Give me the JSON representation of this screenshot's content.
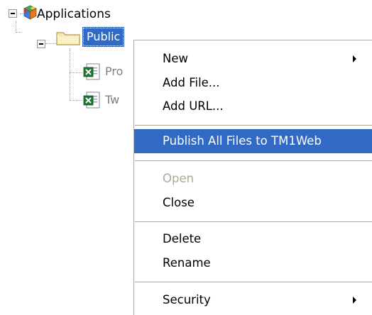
{
  "tree": {
    "root": {
      "label": "Applications",
      "expander": "minus"
    },
    "public": {
      "label": "Public",
      "expander": "minus"
    },
    "children": [
      {
        "label": "Pro",
        "icon": "excel-document-icon"
      },
      {
        "label": "Tw",
        "icon": "excel-document-icon"
      }
    ]
  },
  "context_menu": {
    "items": [
      {
        "label": "New",
        "submenu": true
      },
      {
        "label": "Add File...",
        "submenu": false
      },
      {
        "label": "Add URL...",
        "submenu": false
      },
      {
        "label": "Publish All Files to TM1Web",
        "selected": true
      },
      {
        "label": "Open",
        "disabled": true
      },
      {
        "label": "Close"
      },
      {
        "label": "Delete"
      },
      {
        "label": "Rename"
      },
      {
        "label": "Security",
        "submenu": true
      }
    ]
  },
  "colors": {
    "selection": "#316ac5",
    "disabled_text": "#aca899",
    "separator": "#aca899"
  }
}
